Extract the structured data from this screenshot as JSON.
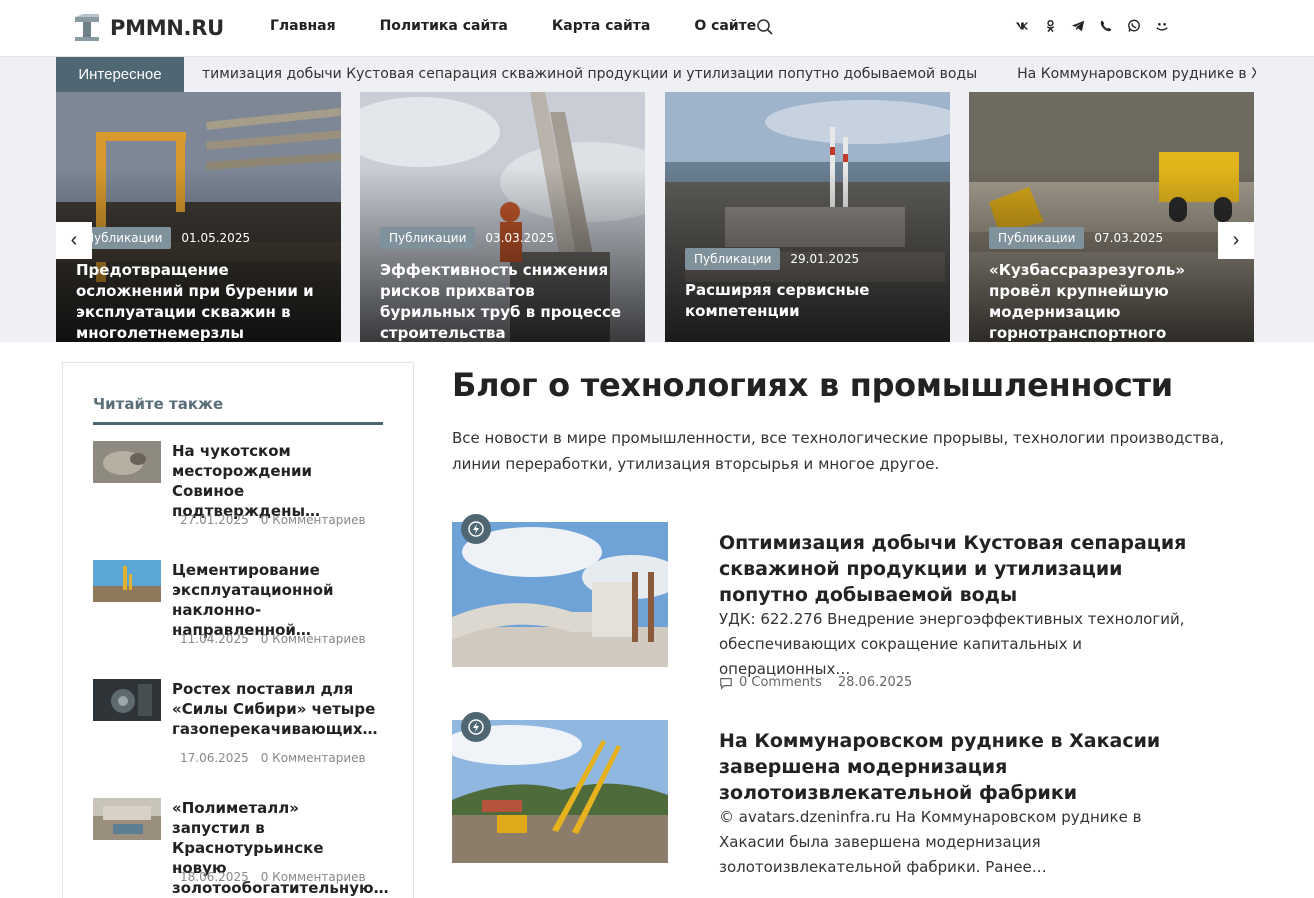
{
  "header": {
    "logo_text": "PMMN.RU",
    "nav": [
      "Главная",
      "Политика сайта",
      "Карта сайта",
      "О сайте"
    ],
    "search_icon": "search-icon",
    "social_icons": [
      "vk-icon",
      "odnoklassniki-icon",
      "telegram-icon",
      "viber-icon",
      "whatsapp-icon",
      "moimir-icon"
    ]
  },
  "ticker": {
    "label": "Интересное",
    "items": [
      "тимизация добычи Кустовая сепарация скважиной продукции и утилизации попутно добываемой воды",
      "На Коммунаровском руднике в Х"
    ]
  },
  "slider": {
    "prev": "‹",
    "next": "›",
    "slides": [
      {
        "category": "Публикации",
        "date": "01.05.2025",
        "title": "Предотвращение осложнений при бурении и эксплуатации скважин в многолетнемерзлы"
      },
      {
        "category": "Публикации",
        "date": "03.03.2025",
        "title": "Эффективность снижения рисков прихватов бурильных труб в процессе строительства"
      },
      {
        "category": "Публикации",
        "date": "29.01.2025",
        "title": "Расширяя сервисные компетенции"
      },
      {
        "category": "Публикации",
        "date": "07.03.2025",
        "title": "«Кузбассразрезуголь» провёл крупнейшую модернизацию горнотранспортного"
      }
    ]
  },
  "sidebar": {
    "title": "Читайте также",
    "items": [
      {
        "title": "На чукотском месторождении Совиное подтверждены…",
        "date": "27.01.2025",
        "comments": "0 Комментариев"
      },
      {
        "title": "Цементирование эксплуатационной наклонно-направленной…",
        "date": "11.04.2025",
        "comments": "0 Комментариев"
      },
      {
        "title": "Ростех поставил для «Силы Сибири» четыре газоперекачивающих…",
        "date": "17.06.2025",
        "comments": "0 Комментариев"
      },
      {
        "title": "«Полиметалл» запустил в Краснотурьинске новую золотообогатительную…",
        "date": "18.06.2025",
        "comments": "0 Комментариев"
      }
    ]
  },
  "main": {
    "title": "Блог о технологиях в промышленности",
    "description": "Все новости в мире промышленности, все технологические прорывы, технологии производства, линии переработки, утилизация вторсырья и многое другое.",
    "posts": [
      {
        "title": "Оптимизация добычи Кустовая сепарация скважиной продукции и утилизации попутно добываемой воды",
        "excerpt": "УДК: 622.276 Внедрение энергоэффективных технологий, обеспечивающих сокращение капитальных и операционных…",
        "comments": "0 Comments",
        "date": "28.06.2025"
      },
      {
        "title": "На Коммунаровском руднике в Хакасии завершена модернизация золотоизвлекательной фабрики",
        "excerpt": " © avatars.dzeninfra.ru На Коммунаровском руднике в Хакасии была завершена модернизация золотоизвлекательной фабрики. Ранее…"
      }
    ]
  },
  "colors": {
    "accent": "#4f6673",
    "badge": "#7f929c",
    "band_bg": "#eef0f3"
  }
}
